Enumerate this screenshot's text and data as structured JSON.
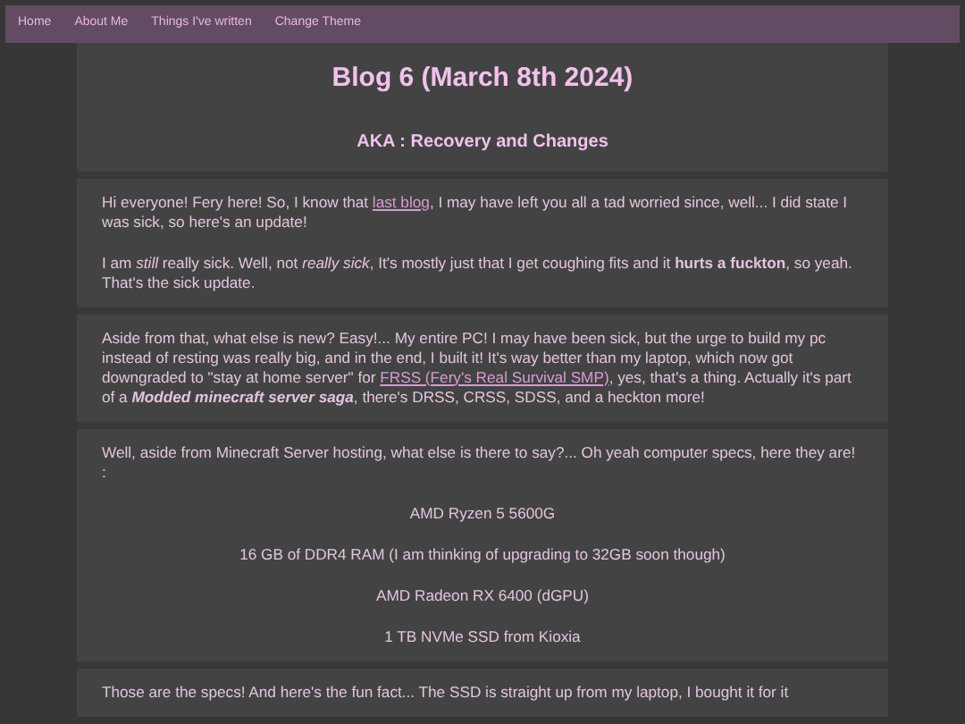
{
  "nav": {
    "items": [
      "Home",
      "About Me",
      "Things I've written",
      "Change Theme"
    ]
  },
  "title": "Blog 6 (March 8th 2024)",
  "subtitle": "AKA : Recovery and Changes",
  "sections": [
    {
      "paragraphs": [
        {
          "kind": "paragraph",
          "parts": [
            {
              "kind": "text",
              "text": "Hi everyone! Fery here! So, I know that "
            },
            {
              "kind": "link",
              "text": "last blog"
            },
            {
              "kind": "text",
              "text": ", I may have left you all a tad worried since, well... I did state I was sick, so here's an update!"
            }
          ]
        },
        {
          "kind": "paragraph",
          "parts": [
            {
              "kind": "text",
              "text": "I am *still* really sick. Well, not *really sick*, It's mostly just that I get coughing fits and it **hurts a fuckton**, so yeah. That's the sick update."
            }
          ]
        }
      ]
    },
    {
      "paragraphs": [
        {
          "kind": "paragraph",
          "parts": [
            {
              "kind": "text",
              "text": "Aside from that, what else is new? Easy!... My entire PC! I may have been sick, but the urge to build my pc instead of resting was really big, and in the end, I built it! It's way better than my laptop, which now got downgraded to \"stay at home server\" for "
            },
            {
              "kind": "link",
              "text": "FRSS (Fery's Real Survival SMP)"
            },
            {
              "kind": "text",
              "text": ", yes, that's a thing. Actually it's part of a "
            },
            {
              "kind": "emphasis",
              "text": "Modded minecraft server saga"
            },
            {
              "kind": "text",
              "text": ", there's DRSS, CRSS, SDSS, and a heckton more!"
            }
          ]
        }
      ]
    },
    {
      "paragraphs": [
        {
          "kind": "paragraph",
          "parts": [
            {
              "kind": "text",
              "text": "Well, aside from Minecraft Server hosting, what else is there to say?... Oh yeah computer specs, here they are! :"
            }
          ]
        },
        {
          "kind": "spec",
          "parts": [
            {
              "kind": "text",
              "text": "AMD Ryzen 5 5600G"
            }
          ]
        },
        {
          "kind": "spec",
          "parts": [
            {
              "kind": "text",
              "text": "16 GB of DDR4 RAM (I am thinking of upgrading to 32GB soon though)"
            }
          ]
        },
        {
          "kind": "spec",
          "parts": [
            {
              "kind": "text",
              "text": "AMD Radeon RX 6400 (dGPU)"
            }
          ]
        },
        {
          "kind": "spec",
          "parts": [
            {
              "kind": "text",
              "text": "1 TB NVMe SSD from Kioxia"
            }
          ]
        }
      ]
    },
    {
      "paragraphs": [
        {
          "kind": "paragraph",
          "parts": [
            {
              "kind": "text",
              "text": "Those are the specs! And here's the fun fact... The SSD is straight up from my laptop, I bought it for it"
            }
          ]
        }
      ]
    }
  ]
}
